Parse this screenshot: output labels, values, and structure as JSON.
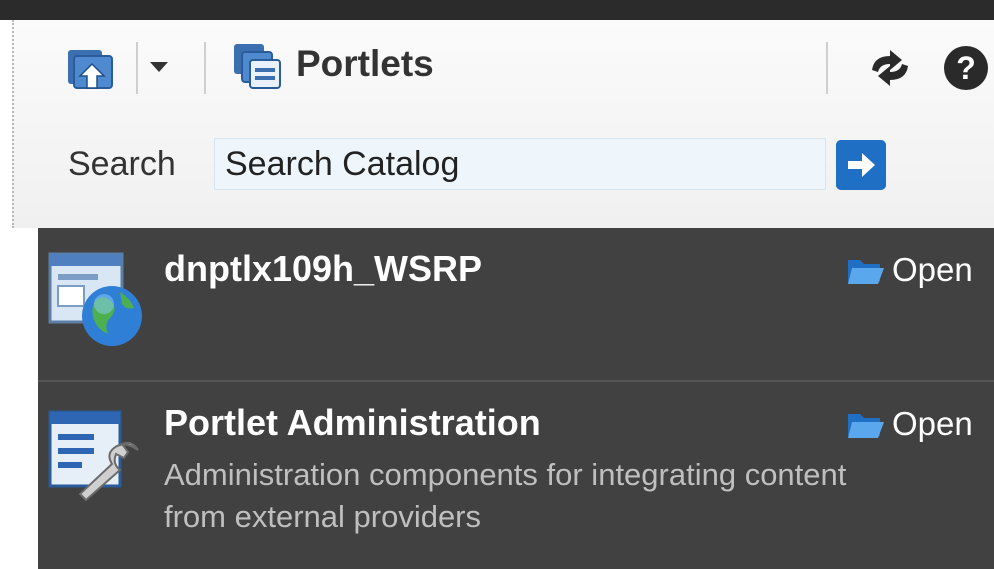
{
  "toolbar": {
    "title": "Portlets",
    "icons": [
      "up-folder-icon",
      "chevron-down-icon",
      "portlets-icon",
      "refresh-icon",
      "help-icon"
    ],
    "help_glyph": "?"
  },
  "search": {
    "label": "Search",
    "placeholder": "Search Catalog",
    "value": ""
  },
  "catalog": {
    "items": [
      {
        "title": "dnptlx109h_WSRP",
        "description": "",
        "action": "Open",
        "icon": "wsrp-globe-icon"
      },
      {
        "title": "Portlet Administration",
        "description": "Administration components for integrating content from external providers",
        "action": "Open",
        "icon": "admin-wrench-icon"
      }
    ]
  },
  "colors": {
    "catalog_bg": "#414141",
    "accent_blue": "#1f6fc5",
    "header_bg": "#f4f4f4"
  }
}
